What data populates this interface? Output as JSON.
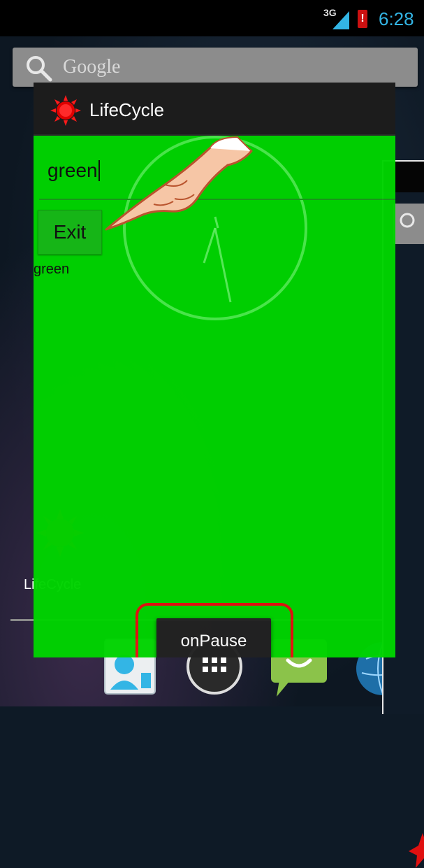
{
  "status_bar": {
    "network": "3G",
    "battery_warning": "!",
    "time": "6:28",
    "time_color": "#33b5e5"
  },
  "home": {
    "search_text": "Google",
    "app_label": "LifeCycle",
    "dock_icons": [
      "contacts-icon",
      "app-drawer-icon",
      "messaging-icon",
      "browser-icon"
    ]
  },
  "app": {
    "title": "LifeCycle",
    "background_color": "#00d400",
    "edit_text": "green",
    "exit_label": "Exit",
    "color_label": "green",
    "toast": "onPause",
    "highlight_color": "#e51010"
  }
}
